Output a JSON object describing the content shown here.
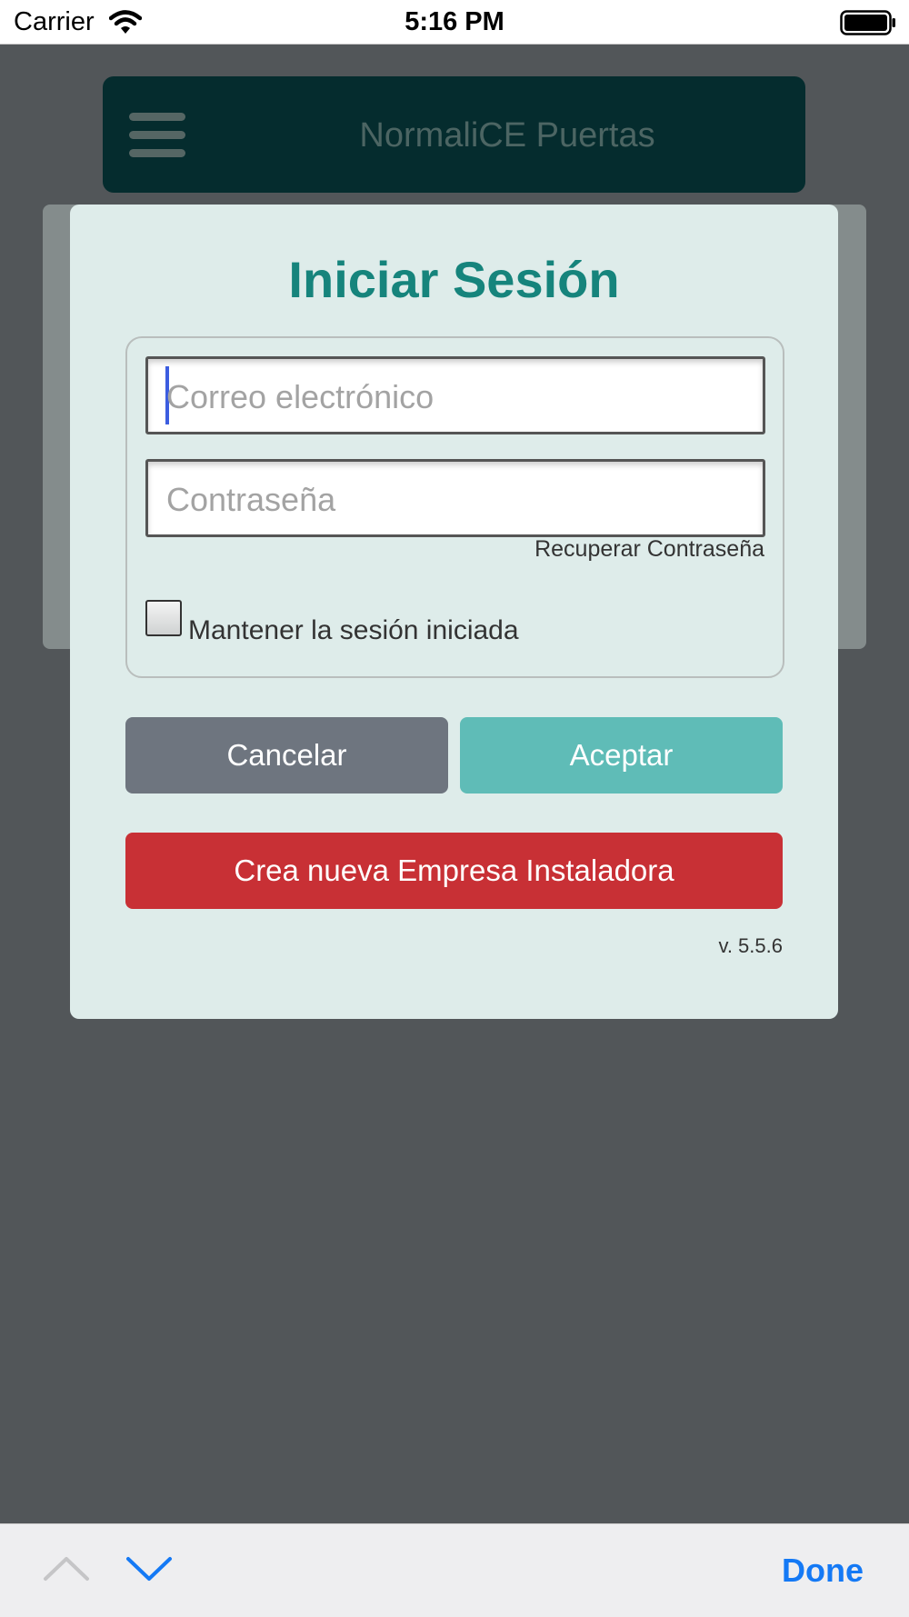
{
  "status_bar": {
    "carrier": "Carrier",
    "time": "5:16 PM"
  },
  "header": {
    "title": "NormaliCE Puertas"
  },
  "login": {
    "title": "Iniciar Sesión",
    "email_placeholder": "Correo electrónico",
    "password_placeholder": "Contraseña",
    "recover_password": "Recuperar Contraseña",
    "remember_label": "Mantener la sesión iniciada",
    "remember_checked": false,
    "cancel_label": "Cancelar",
    "accept_label": "Aceptar",
    "create_company_label": "Crea nueva Empresa Instaladora",
    "version": "v. 5.5.6"
  },
  "keyboard_toolbar": {
    "done_label": "Done"
  },
  "colors": {
    "accent": "#16847c",
    "accept": "#5fbcb7",
    "cancel": "#6e757f",
    "create": "#c83035",
    "done": "#1479f5"
  }
}
